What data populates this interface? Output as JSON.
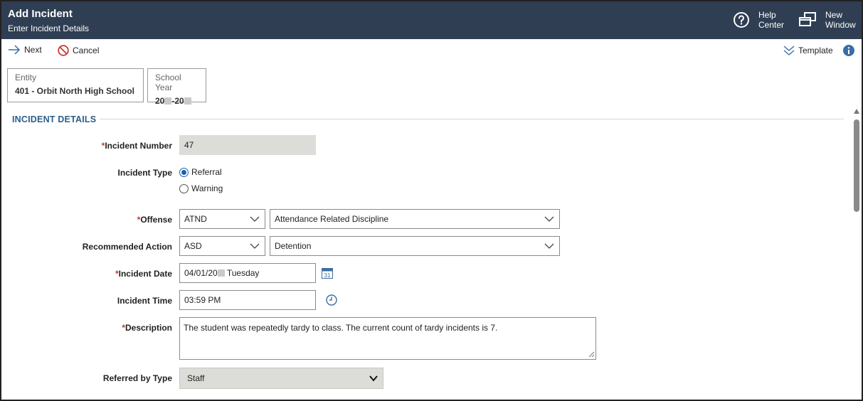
{
  "header": {
    "title": "Add Incident",
    "subtitle": "Enter Incident Details",
    "help_line1": "Help",
    "help_line2": "Center",
    "newwin_line1": "New",
    "newwin_line2": "Window"
  },
  "toolbar": {
    "next_label": "Next",
    "cancel_label": "Cancel",
    "template_label": "Template"
  },
  "context": {
    "entity_label": "Entity",
    "entity_value": "401 - Orbit North High School",
    "year_label": "School Year",
    "year_part1": "20",
    "year_part2": "-20"
  },
  "section": {
    "title": "INCIDENT DETAILS"
  },
  "form": {
    "incident_number_label": "Incident Number",
    "incident_number_value": "47",
    "incident_type_label": "Incident Type",
    "incident_type_options": [
      "Referral",
      "Warning"
    ],
    "incident_type_selected": "Referral",
    "offense_label": "Offense",
    "offense_code": "ATND",
    "offense_desc": "Attendance Related Discipline",
    "rec_action_label": "Recommended Action",
    "rec_action_code": "ASD",
    "rec_action_desc": "Detention",
    "incident_date_label": "Incident Date",
    "incident_date_prefix": "04/01/20",
    "incident_date_suffix": " Tuesday",
    "calendar_day": "31",
    "incident_time_label": "Incident Time",
    "incident_time_value": "03:59 PM",
    "description_label": "Description",
    "description_value": "The student was repeatedly tardy to class. The current count of tardy incidents is 7.",
    "referred_by_type_label": "Referred by Type",
    "referred_by_type_value": "Staff"
  },
  "colors": {
    "header_bg": "#2f3e53",
    "section_title": "#2b5f8a",
    "required_star": "#c0392b",
    "disabled_bg": "#dcdcd8",
    "accent_blue": "#1a5fb4"
  }
}
